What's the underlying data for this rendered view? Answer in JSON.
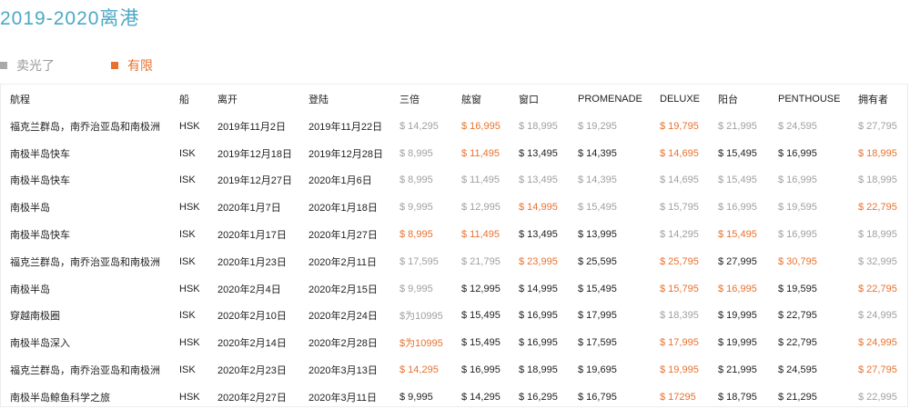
{
  "page": {
    "title": "2019-2020离港"
  },
  "legend": {
    "sold_out_label": "卖光了",
    "limited_label": "有限",
    "sold_out_color": "#a9a9a9",
    "limited_color": "#e8712f"
  },
  "table": {
    "headers": [
      "航程",
      "船",
      "离开",
      "登陆",
      "三倍",
      "舷窗",
      "窗口",
      "PROMENADE",
      "DELUXE",
      "阳台",
      "PENTHOUSE",
      "拥有者"
    ],
    "rows": [
      {
        "cells": [
          "福克兰群岛，南乔治亚岛和南极洲",
          "HSK",
          "2019年11月2日",
          "2019年11月22日",
          "$ 14,295",
          "$ 16,995",
          "$ 18,995",
          "$ 19,295",
          "$ 19,795",
          "$ 21,995",
          "$ 24,595",
          "$ 27,795"
        ],
        "status": [
          "",
          "",
          "",
          "",
          "sold",
          "limited",
          "sold",
          "sold",
          "limited",
          "sold",
          "sold",
          "sold"
        ]
      },
      {
        "cells": [
          "南极半岛快车",
          "ISK",
          "2019年12月18日",
          "2019年12月28日",
          "$ 8,995",
          "$ 11,495",
          "$ 13,495",
          "$ 14,395",
          "$ 14,695",
          "$ 15,495",
          "$ 16,995",
          "$ 18,995"
        ],
        "status": [
          "",
          "",
          "",
          "",
          "sold",
          "limited",
          "",
          "",
          "limited",
          "",
          "",
          "limited"
        ]
      },
      {
        "cells": [
          "南极半岛快车",
          "ISK",
          "2019年12月27日",
          "2020年1月6日",
          "$ 8,995",
          "$ 11,495",
          "$ 13,495",
          "$ 14,395",
          "$ 14,695",
          "$ 15,495",
          "$ 16,995",
          "$ 18,995"
        ],
        "status": [
          "",
          "",
          "",
          "",
          "sold",
          "sold",
          "sold",
          "sold",
          "sold",
          "sold",
          "sold",
          "sold"
        ]
      },
      {
        "cells": [
          "南极半岛",
          "HSK",
          "2020年1月7日",
          "2020年1月18日",
          "$ 9,995",
          "$ 12,995",
          "$ 14,995",
          "$ 15,495",
          "$ 15,795",
          "$ 16,995",
          "$ 19,595",
          "$ 22,795"
        ],
        "status": [
          "",
          "",
          "",
          "",
          "sold",
          "sold",
          "limited",
          "sold",
          "sold",
          "sold",
          "sold",
          "limited"
        ]
      },
      {
        "cells": [
          "南极半岛快车",
          "ISK",
          "2020年1月17日",
          "2020年1月27日",
          "$ 8,995",
          "$ 11,495",
          "$ 13,495",
          "$ 13,995",
          "$ 14,295",
          "$ 15,495",
          "$ 16,995",
          "$ 18,995"
        ],
        "status": [
          "",
          "",
          "",
          "",
          "limited",
          "limited",
          "",
          "",
          "sold",
          "limited",
          "sold",
          "sold"
        ]
      },
      {
        "cells": [
          "福克兰群岛，南乔治亚岛和南极洲",
          "ISK",
          "2020年1月23日",
          "2020年2月11日",
          "$ 17,595",
          "$ 21,795",
          "$ 23,995",
          "$ 25,595",
          "$ 25,795",
          "$ 27,995",
          "$ 30,795",
          "$ 32,995"
        ],
        "status": [
          "",
          "",
          "",
          "",
          "sold",
          "sold",
          "limited",
          "",
          "limited",
          "",
          "limited",
          "sold"
        ]
      },
      {
        "cells": [
          "南极半岛",
          "HSK",
          "2020年2月4日",
          "2020年2月15日",
          "$ 9,995",
          "$ 12,995",
          "$ 14,995",
          "$ 15,495",
          "$ 15,795",
          "$ 16,995",
          "$ 19,595",
          "$ 22,795"
        ],
        "status": [
          "",
          "",
          "",
          "",
          "sold",
          "",
          "",
          "",
          "limited",
          "limited",
          "",
          "limited"
        ]
      },
      {
        "cells": [
          "穿越南极圈",
          "ISK",
          "2020年2月10日",
          "2020年2月24日",
          "$为10995",
          "$ 15,495",
          "$ 16,995",
          "$ 17,995",
          "$ 18,395",
          "$ 19,995",
          "$ 22,795",
          "$ 24,995"
        ],
        "status": [
          "",
          "",
          "",
          "",
          "sold",
          "",
          "",
          "",
          "sold",
          "",
          "",
          "sold"
        ]
      },
      {
        "cells": [
          "南极半岛深入",
          "HSK",
          "2020年2月14日",
          "2020年2月28日",
          "$为10995",
          "$ 15,495",
          "$ 16,995",
          "$ 17,595",
          "$ 17,995",
          "$ 19,995",
          "$ 22,795",
          "$ 24,995"
        ],
        "status": [
          "",
          "",
          "",
          "",
          "limited",
          "",
          "",
          "",
          "limited",
          "",
          "",
          "limited"
        ]
      },
      {
        "cells": [
          "福克兰群岛，南乔治亚岛和南极洲",
          "ISK",
          "2020年2月23日",
          "2020年3月13日",
          "$ 14,295",
          "$ 16,995",
          "$ 18,995",
          "$ 19,695",
          "$ 19,995",
          "$ 21,995",
          "$ 24,595",
          "$ 27,795"
        ],
        "status": [
          "",
          "",
          "",
          "",
          "limited",
          "",
          "",
          "",
          "limited",
          "",
          "",
          "limited"
        ]
      },
      {
        "cells": [
          "南极半岛鲸鱼科学之旅",
          "HSK",
          "2020年2月27日",
          "2020年3月11日",
          "$ 9,995",
          "$ 14,295",
          "$ 16,295",
          "$ 16,795",
          "$ 17295",
          "$ 18,795",
          "$ 21,295",
          "$ 22,995"
        ],
        "status": [
          "",
          "",
          "",
          "",
          "",
          "",
          "",
          "",
          "limited",
          "",
          "",
          "sold"
        ]
      }
    ]
  }
}
